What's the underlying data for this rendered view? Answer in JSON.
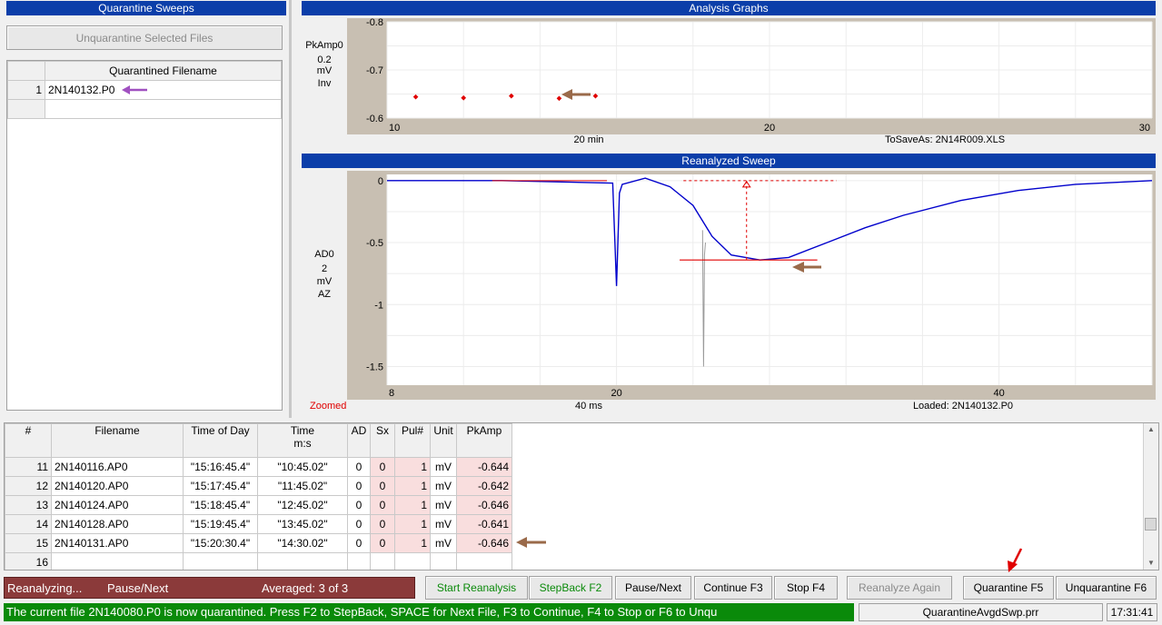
{
  "quarantine": {
    "title": "Quarantine Sweeps",
    "unquarantine_button": "Unquarantine Selected Files",
    "table_header": "Quarantined Filename",
    "rows": [
      {
        "num": "1",
        "filename": "2N140132.P0"
      },
      {
        "num": "",
        "filename": ""
      }
    ]
  },
  "analysis": {
    "title": "Analysis Graphs",
    "side_labels": {
      "channel": "PkAmp0",
      "scale": "0.2",
      "unit": "mV",
      "mode": "Inv"
    },
    "footer_center": "20 min",
    "footer_right": "ToSaveAs: 2N14R009.XLS",
    "chart_data": {
      "type": "scatter",
      "title": "",
      "xlabel": "",
      "ylabel": "",
      "xlim": [
        10,
        30
      ],
      "ylim": [
        -0.6,
        -0.8
      ],
      "y_inverted": true,
      "x_ticks": [
        "10",
        "20",
        "30"
      ],
      "y_ticks": [
        "-0.8",
        "-0.7",
        "-0.6"
      ],
      "series": [
        {
          "x": [
            10.75,
            12.0,
            13.25,
            14.5,
            15.45
          ],
          "values": [
            -0.644,
            -0.642,
            -0.646,
            -0.641,
            -0.646
          ],
          "color": "#e00000"
        }
      ],
      "grid": true
    }
  },
  "sweep": {
    "title": "Reanalyzed Sweep",
    "side_labels": {
      "channel": "AD0",
      "scale": "2",
      "unit": "mV",
      "mode": "AZ"
    },
    "zoom_label": "Zoomed",
    "footer_center": "40 ms",
    "footer_right": "Loaded: 2N140132.P0",
    "chart_data": {
      "type": "line",
      "title": "",
      "xlabel": "",
      "ylabel": "",
      "xlim": [
        8,
        48
      ],
      "ylim": [
        -1.65,
        0.05
      ],
      "x_ticks": [
        "8",
        "20",
        "40"
      ],
      "y_ticks": [
        "0",
        "-0.5",
        "-1",
        "-1.5"
      ],
      "grid": true,
      "series": [
        {
          "name": "",
          "color": "#0000cc",
          "x": [
            8,
            14,
            19.8,
            20.0,
            20.15,
            20.3,
            21.5,
            22.8,
            23.2,
            24.0,
            25.0,
            26.0,
            27.5,
            29,
            31,
            33,
            35,
            38,
            41,
            44,
            48
          ],
          "values": [
            0,
            0,
            -0.02,
            -0.85,
            -0.1,
            -0.03,
            0.02,
            -0.05,
            -0.1,
            -0.2,
            -0.45,
            -0.6,
            -0.64,
            -0.62,
            -0.5,
            -0.38,
            -0.28,
            -0.16,
            -0.08,
            -0.03,
            0
          ]
        },
        {
          "name": "",
          "color": "#9a9a9a",
          "x": [
            24.5,
            24.55,
            24.6,
            24.65
          ],
          "values": [
            -0.4,
            -1.5,
            -0.6,
            -0.5
          ]
        }
      ],
      "peak": {
        "x": 26.8,
        "value": -0.64,
        "baseline": 0
      }
    }
  },
  "table": {
    "headers": [
      {
        "label": "#"
      },
      {
        "label": "Filename"
      },
      {
        "label": "Time of Day"
      },
      {
        "label": "Time\nm:s"
      },
      {
        "label": "AD"
      },
      {
        "label": "Sx"
      },
      {
        "label": "Pul#"
      },
      {
        "label": "Unit"
      },
      {
        "label": "PkAmp"
      }
    ],
    "rows": [
      {
        "n": "11",
        "file": "2N140116.AP0",
        "tod": "\"15:16:45.4\"",
        "t": "\"10:45.02\"",
        "ad": "0",
        "sx": "0",
        "pul": "1",
        "unit": "mV",
        "pk": "-0.644"
      },
      {
        "n": "12",
        "file": "2N140120.AP0",
        "tod": "\"15:17:45.4\"",
        "t": "\"11:45.02\"",
        "ad": "0",
        "sx": "0",
        "pul": "1",
        "unit": "mV",
        "pk": "-0.642"
      },
      {
        "n": "13",
        "file": "2N140124.AP0",
        "tod": "\"15:18:45.4\"",
        "t": "\"12:45.02\"",
        "ad": "0",
        "sx": "0",
        "pul": "1",
        "unit": "mV",
        "pk": "-0.646"
      },
      {
        "n": "14",
        "file": "2N140128.AP0",
        "tod": "\"15:19:45.4\"",
        "t": "\"13:45.02\"",
        "ad": "0",
        "sx": "0",
        "pul": "1",
        "unit": "mV",
        "pk": "-0.641"
      },
      {
        "n": "15",
        "file": "2N140131.AP0",
        "tod": "\"15:20:30.4\"",
        "t": "\"14:30.02\"",
        "ad": "0",
        "sx": "0",
        "pul": "1",
        "unit": "mV",
        "pk": "-0.646"
      },
      {
        "n": "16",
        "file": "",
        "tod": "",
        "t": "",
        "ad": "",
        "sx": "",
        "pul": "",
        "unit": "",
        "pk": ""
      }
    ]
  },
  "status": {
    "reanalyzing": "Reanalyzing...",
    "pause_next": "Pause/Next",
    "averaged": "Averaged: 3 of 3",
    "message": "The current file 2N140080.P0 is now quarantined.  Press F2 to StepBack,  SPACE for Next File,  F3 to Continue,  F4 to Stop  or  F6 to Unqu",
    "protocol": "QuarantineAvgdSwp.prr",
    "clock": "17:31:41"
  },
  "buttons": {
    "start": "Start Reanalysis",
    "stepback": "StepBack  F2",
    "pause": "Pause/Next",
    "continue": "Continue  F3",
    "stop": "Stop  F4",
    "again": "Reanalyze Again",
    "quarantine": "Quarantine  F5",
    "unquarantine": "Unquarantine  F6"
  },
  "colors": {
    "title_bar": "#0b3ea9",
    "plot_frame": "#c8bfb2",
    "status_green": "#0a8a0a",
    "status_red": "#8b3a3a",
    "marker_red": "#e00000",
    "trace_blue": "#0000cc",
    "arrow_brown": "#9a6a4a",
    "arrow_purple": "#a050c0"
  }
}
